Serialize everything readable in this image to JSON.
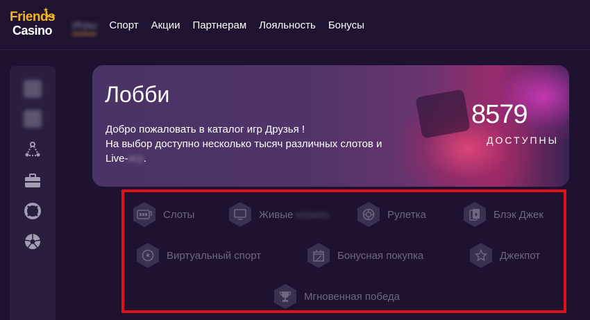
{
  "logo": {
    "line1": "Friends",
    "line2": "Casino"
  },
  "nav": {
    "items": [
      {
        "label": "Игры",
        "blurred": true,
        "active": true
      },
      {
        "label": "Спорт"
      },
      {
        "label": "Акции"
      },
      {
        "label": "Партнерам"
      },
      {
        "label": "Лояльность"
      },
      {
        "label": "Бонусы"
      }
    ]
  },
  "sidebar": {
    "icons": [
      "blurred-icon",
      "blurred-icon",
      "network-icon",
      "briefcase-icon",
      "lifebuoy-icon",
      "soccer-ball-icon"
    ]
  },
  "banner": {
    "title": "Лобби",
    "desc_line1": "Добро пожаловать в каталог игр Друзья !",
    "desc_line2": "На выбор доступно несколько тысяч различных слотов и",
    "desc_line3_prefix": "Live-",
    "desc_line3_blurred": "игр",
    "desc_line3_suffix": ".",
    "count": "8579",
    "count_label": "ДОСТУПНЫ"
  },
  "categories": {
    "slots": "Слоты",
    "live_prefix": "Живые",
    "live_blurred": "казино",
    "roulette": "Рулетка",
    "blackjack": "Блэк Джек",
    "virtual_sport": "Виртуальный спорт",
    "bonus_buy": "Бонусная покупка",
    "jackpot": "Джекпот",
    "instant_win": "Мгновенная победа"
  },
  "colors": {
    "background": "#1e1230",
    "accent": "#d9a23a",
    "highlight_border": "#e0101c",
    "category_text": "#6f6680"
  }
}
